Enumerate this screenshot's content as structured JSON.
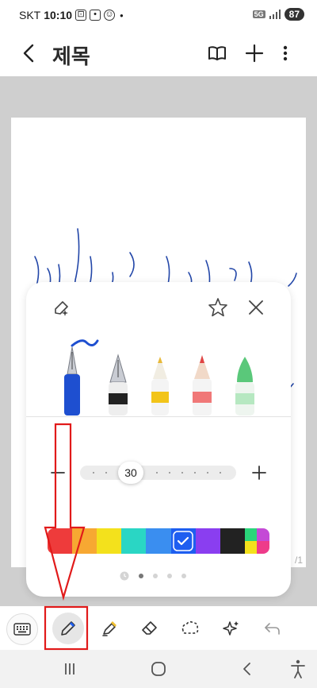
{
  "status_bar": {
    "carrier": "SKT",
    "time": "10:10",
    "network": "5G",
    "battery": "87"
  },
  "app_bar": {
    "title": "제목"
  },
  "canvas": {
    "page_indicator": "/1"
  },
  "pen_popup": {
    "size_value": "30",
    "pens": [
      "fountain-pen",
      "calligraphy-pen",
      "pen",
      "pencil",
      "highlighter"
    ],
    "selected_pen": "fountain-pen",
    "colors": [
      "#ee3b3b",
      "#f7a832",
      "#f3e11c",
      "#2ad6c4",
      "#3a8ef0",
      "#1e5ef0",
      "#8a3ef0",
      "#222222"
    ],
    "selected_color": "#1e5ef0",
    "page_count": 5,
    "active_page": 1
  },
  "toolbar": {
    "tools": [
      "keyboard",
      "pen",
      "highlighter",
      "eraser",
      "lasso",
      "ai-assist",
      "undo"
    ],
    "active_tool": "pen"
  },
  "annotations": {
    "color": "#e11a1a"
  }
}
